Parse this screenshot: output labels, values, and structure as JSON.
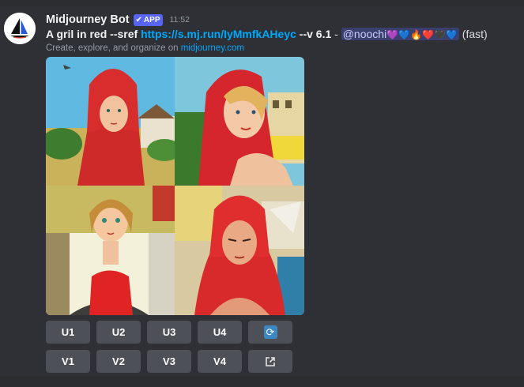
{
  "bot": {
    "name": "Midjourney Bot",
    "badge": "APP",
    "time": "11:52"
  },
  "message": {
    "prompt": "A gril in red",
    "sref_flag": "--sref",
    "sref_url": "https://s.mj.run/IyMmfkAHeyc",
    "version_flag": "--v 6.1",
    "separator": "-",
    "mention": "@noochi",
    "hearts": [
      "💜",
      "💙",
      "🔥",
      "❤️",
      "🖤",
      "💙"
    ],
    "speed": "(fast)",
    "subtext_prefix": "Create, explore, and organize on",
    "subtext_link": "midjourney.com"
  },
  "buttons": {
    "row1": [
      "U1",
      "U2",
      "U3",
      "U4"
    ],
    "row2": [
      "V1",
      "V2",
      "V3",
      "V4"
    ],
    "reroll_icon": "refresh-icon",
    "open_icon": "external-link-icon"
  },
  "colors": {
    "background": "#313338",
    "brand": "#5865f2",
    "link": "#00a8fc",
    "button": "#4e5058"
  }
}
